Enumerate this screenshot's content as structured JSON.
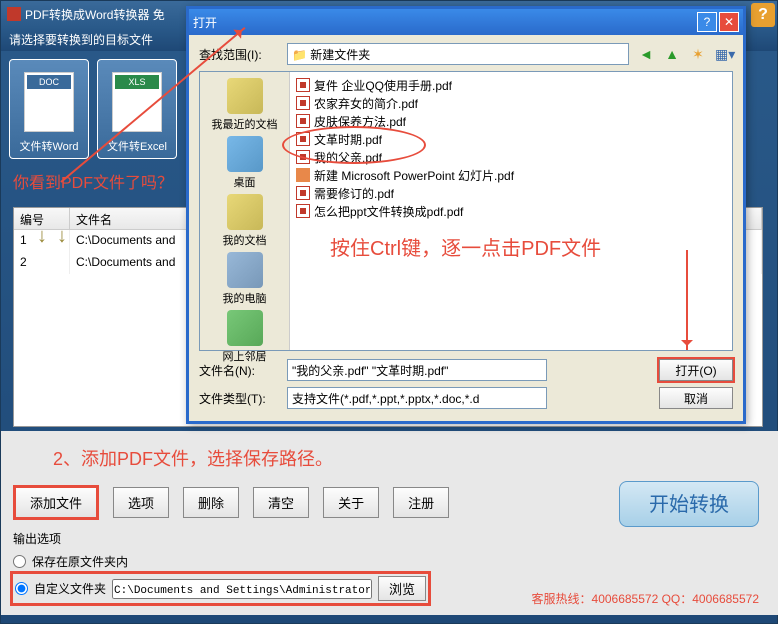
{
  "main": {
    "title": "PDF转换成Word转换器 免",
    "subtitle": "请选择要转换到的目标文件",
    "help_icon": "?",
    "tiles": [
      {
        "label": "文件转Word",
        "type": "doc"
      },
      {
        "label": "文件转Excel",
        "type": "xls"
      }
    ],
    "annotation_see_pdf": "你看到PDF文件了吗？"
  },
  "file_list": {
    "headers": {
      "num": "编号",
      "name": "文件名"
    },
    "rows": [
      {
        "num": "1",
        "name": "C:\\Documents and"
      },
      {
        "num": "2",
        "name": "C:\\Documents and"
      }
    ]
  },
  "bottom": {
    "step_label": "2、添加PDF文件，选择保存路径。",
    "buttons": {
      "add": "添加文件",
      "options": "选项",
      "delete": "删除",
      "clear": "清空",
      "about": "关于",
      "register": "注册"
    },
    "output_label": "输出选项",
    "radio_same": "保存在原文件夹内",
    "radio_custom": "自定义文件夹",
    "custom_path": "C:\\Documents and Settings\\Administrator\\桌面",
    "browse": "浏览",
    "start": "开始转换",
    "hotline": "客服热线：4006685572 QQ：4006685572"
  },
  "dialog": {
    "title": "打开",
    "lookin_label": "查找范围(I):",
    "lookin_value": "新建文件夹",
    "places": {
      "recent": "我最近的文档",
      "desktop": "桌面",
      "mydocs": "我的文档",
      "mycomp": "我的电脑",
      "network": "网上邻居"
    },
    "files": [
      "复件 企业QQ使用手册.pdf",
      "农家弃女的简介.pdf",
      "皮肤保养方法.pdf",
      "文革时期.pdf",
      "我的父亲.pdf",
      "新建 Microsoft PowerPoint 幻灯片.pdf",
      "需要修订的.pdf",
      "怎么把ppt文件转换成pdf.pdf"
    ],
    "file_icons": [
      "pdf",
      "pdf",
      "pdf",
      "pdf",
      "pdf",
      "ppt",
      "pdf",
      "pdf"
    ],
    "note": "按住Ctrl键，逐一点击PDF文件",
    "filename_label": "文件名(N):",
    "filename_value": "\"我的父亲.pdf\" \"文革时期.pdf\"",
    "filetype_label": "文件类型(T):",
    "filetype_value": "支持文件(*.pdf,*.ppt,*.pptx,*.doc,*.d",
    "open_btn": "打开(O)",
    "cancel_btn": "取消"
  }
}
